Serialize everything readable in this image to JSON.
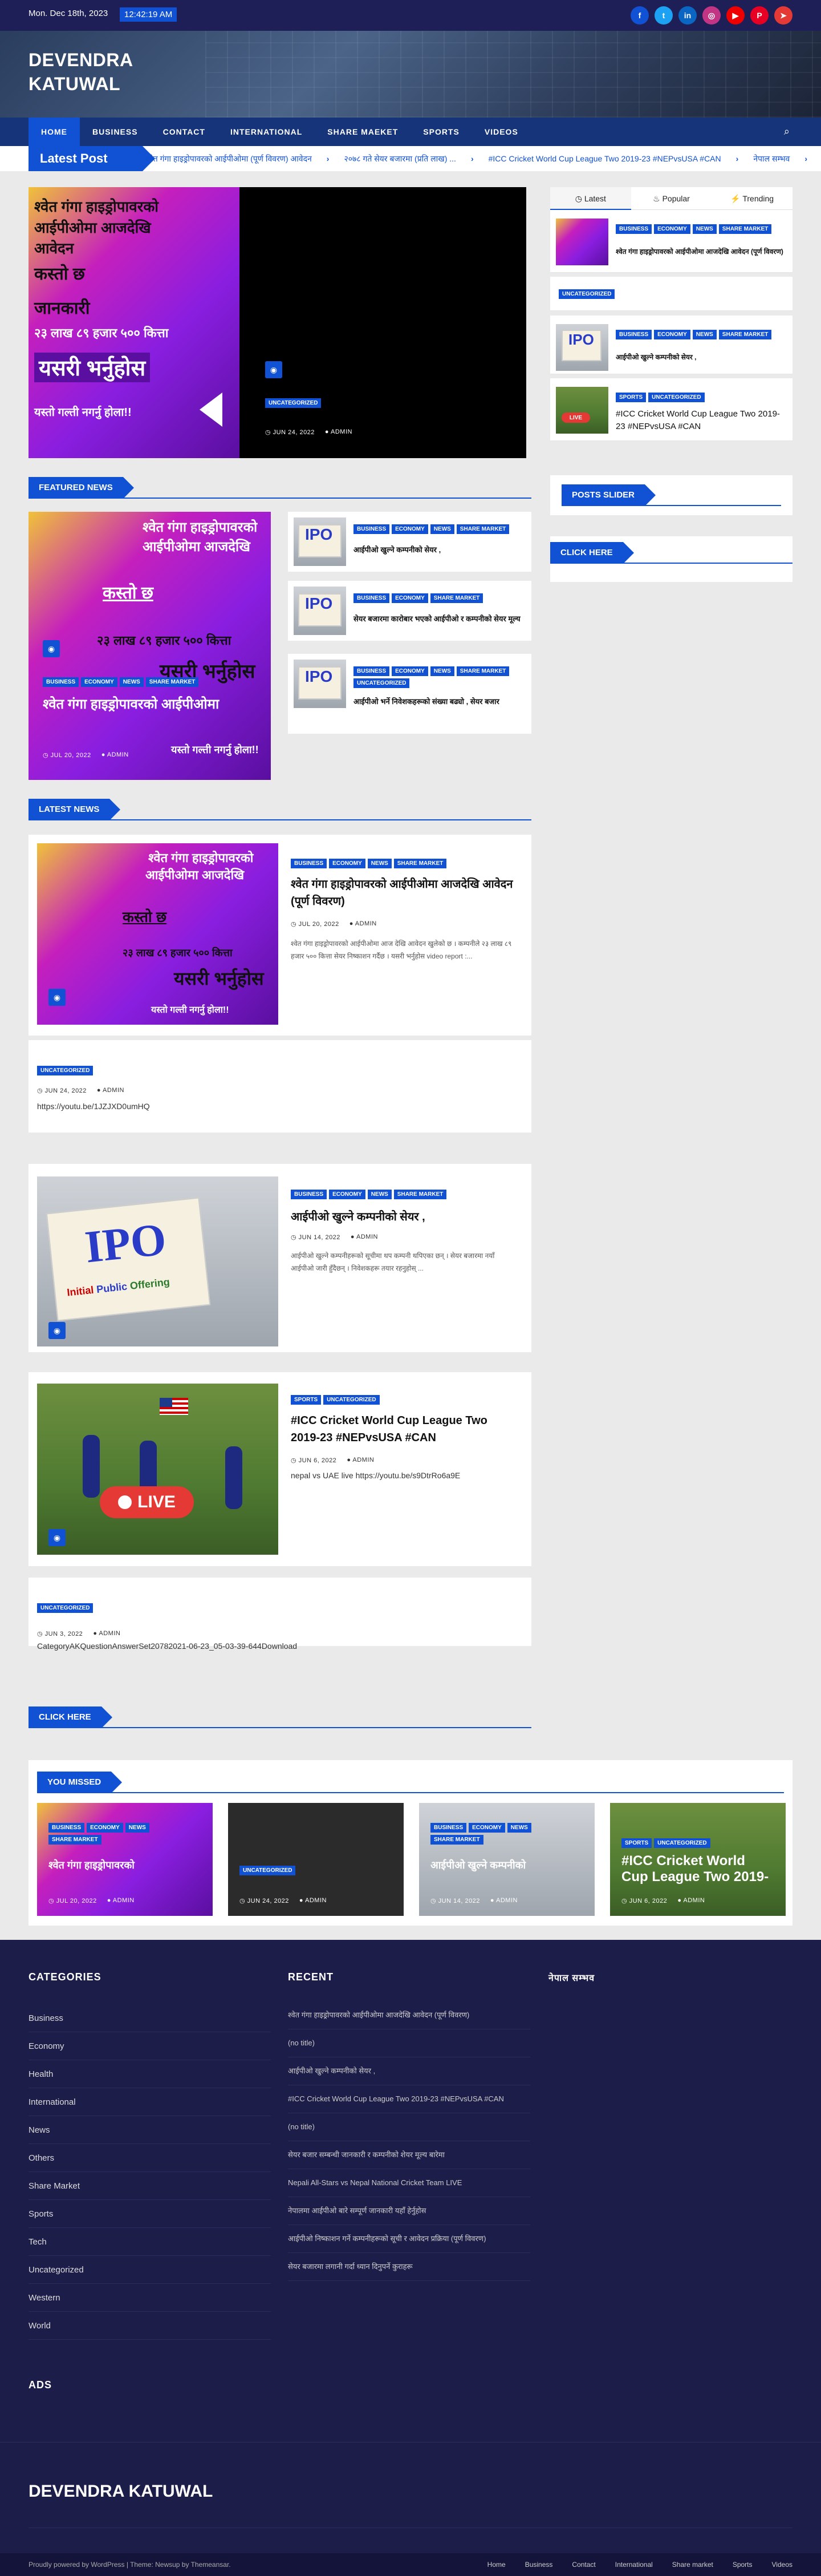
{
  "topbar": {
    "date": "Mon. Dec 18th, 2023",
    "time": "12:42:19 AM",
    "socials": [
      {
        "icon": "facebook-icon",
        "glyph": "f",
        "color": "#1151d3"
      },
      {
        "icon": "twitter-icon",
        "glyph": "t",
        "color": "#1da1f2"
      },
      {
        "icon": "linkedin-icon",
        "glyph": "in",
        "color": "#0a66c2"
      },
      {
        "icon": "instagram-icon",
        "glyph": "◎",
        "color": "#c13584"
      },
      {
        "icon": "youtube-icon",
        "glyph": "▶",
        "color": "#e00"
      },
      {
        "icon": "pinterest-icon",
        "glyph": "P",
        "color": "#e60023"
      },
      {
        "icon": "telegram-icon",
        "glyph": "➤",
        "color": "#e53935"
      }
    ]
  },
  "site": {
    "title": "DEVENDRA KATUWAL"
  },
  "nav": {
    "items": [
      "HOME",
      "BUSINESS",
      "CONTACT",
      "INTERNATIONAL",
      "SHARE MAEKET",
      "SPORTS",
      "VIDEOS"
    ],
    "search_icon": "search-icon"
  },
  "ticker": {
    "label": "Latest Post",
    "items": [
      "श्वेत गंगा हाइड्रोपावरको आईपीओमा (पूर्ण विवरण) आवेदन",
      "२०७८ गते सेयर बजारमा (प्रति लाख) ...",
      "#ICC Cricket World Cup League Two 2019-23 #NEPvsUSA #CAN",
      "नेपाल सम्भव"
    ]
  },
  "hero": {
    "main_image_lines": [
      "श्वेत गंगा हाइड्रोपावरको",
      "आईपीओमा आजदेखि",
      "आवेदन",
      "कस्तो छ",
      "जानकारी",
      "२३ लाख ८९ हजार ५०० कित्ता",
      "यसरी भर्नुहोस",
      "यस्तो गल्ती नगर्नु होला!!"
    ],
    "second_badge": "UNCATEGORIZED",
    "second_date": "JUN 24, 2022",
    "second_author": "ADMIN"
  },
  "sidebar": {
    "tabs": [
      "Latest",
      "Popular",
      "Trending"
    ],
    "items": [
      {
        "badges": [
          "BUSINESS",
          "ECONOMY",
          "NEWS",
          "SHARE MARKET"
        ],
        "title": "श्वेत गंगा हाइड्रोपावरको आईपीओमा आजदेखि आवेदन (पूर्ण विवरण)"
      },
      {
        "badges": [
          "UNCATEGORIZED"
        ],
        "title": ""
      },
      {
        "badges": [
          "BUSINESS",
          "ECONOMY",
          "NEWS",
          "SHARE MARKET"
        ],
        "title": "आईपीओ खुल्ने कम्पनीको सेयर ,"
      },
      {
        "badges": [
          "SPORTS",
          "UNCATEGORIZED"
        ],
        "title": "#ICC Cricket World Cup League Two 2019-23 #NEPvsUSA #CAN"
      }
    ],
    "posts_slider": "POSTS SLIDER",
    "click_here": "CLICK HERE"
  },
  "featured": {
    "title": "FEATURED NEWS",
    "main": {
      "badges": [
        "BUSINESS",
        "ECONOMY",
        "NEWS",
        "SHARE MARKET"
      ],
      "title": "श्वेत गंगा हाइड्रोपावरको आईपीओमा",
      "date": "JUL 20, 2022",
      "author": "ADMIN"
    },
    "side": [
      {
        "badges": [
          "BUSINESS",
          "ECONOMY",
          "NEWS",
          "SHARE MARKET"
        ],
        "title": "आईपीओ खुल्ने कम्पनीको सेयर ,"
      },
      {
        "badges": [
          "BUSINESS",
          "ECONOMY",
          "SHARE MARKET"
        ],
        "title": "सेयर बजारमा कारोबार भएको आईपीओ र कम्पनीको सेयर मूल्य"
      },
      {
        "badges": [
          "BUSINESS",
          "ECONOMY",
          "NEWS",
          "SHARE MARKET",
          "UNCATEGORIZED"
        ],
        "title": "आईपीओ भर्ने निवेशकहरूको संख्या बढ्यो , सेयर बजार"
      }
    ]
  },
  "latest": {
    "title": "LATEST NEWS",
    "posts": [
      {
        "badges": [
          "BUSINESS",
          "ECONOMY",
          "NEWS",
          "SHARE MARKET"
        ],
        "title": "श्वेत गंगा हाइड्रोपावरको आईपीओमा आजदेखि आवेदन (पूर्ण विवरण)",
        "date": "JUL 20, 2022",
        "author": "ADMIN",
        "excerpt": "श्वेत गंगा हाइड्रोपावरको आईपीओमा आज देखि आवेदन खुलेको छ । कम्पनीले २३ लाख ८९ हजार ५०० कित्ता सेयर निष्काशन गर्दैछ । यसरी भर्नुहोस video report :..."
      },
      {
        "badges": [
          "UNCATEGORIZED"
        ],
        "title": "",
        "date": "JUN 24, 2022",
        "author": "ADMIN",
        "excerpt": "https://youtu.be/1JZJXD0umHQ"
      },
      {
        "badges": [
          "BUSINESS",
          "ECONOMY",
          "NEWS",
          "SHARE MARKET"
        ],
        "title": "आईपीओ खुल्ने कम्पनीको सेयर ,",
        "date": "JUN 14, 2022",
        "author": "ADMIN",
        "excerpt": "आईपीओ खुल्ने कम्पनीहरूको सूचीमा थप कम्पनी थपिएका छन् । सेयर बजारमा नयाँ आईपीओ जारी हुँदैछन् । निवेशकहरू तयार रहनुहोस् ..."
      },
      {
        "badges": [
          "SPORTS",
          "UNCATEGORIZED"
        ],
        "title": "#ICC Cricket World Cup League Two 2019-23 #NEPvsUSA #CAN",
        "date": "JUN 6, 2022",
        "author": "ADMIN",
        "excerpt": "nepal vs UAE live https://youtu.be/s9DtrRo6a9E"
      },
      {
        "badges": [
          "UNCATEGORIZED"
        ],
        "title": "",
        "date": "JUN 3, 2022",
        "author": "ADMIN",
        "excerpt": "CategoryAKQuestionAnswerSet20782021-06-23_05-03-39-644Download"
      }
    ],
    "click_here": "CLICK HERE"
  },
  "missed": {
    "title": "YOU MISSED",
    "items": [
      {
        "badges": [
          "BUSINESS",
          "ECONOMY",
          "NEWS",
          "SHARE MARKET"
        ],
        "title": "श्वेत गंगा हाइड्रोपावरको",
        "date": "JUL 20, 2022",
        "author": "ADMIN"
      },
      {
        "badges": [
          "UNCATEGORIZED"
        ],
        "title": "",
        "date": "JUN 24, 2022",
        "author": "ADMIN"
      },
      {
        "badges": [
          "BUSINESS",
          "ECONOMY",
          "NEWS",
          "SHARE MARKET"
        ],
        "title": "आईपीओ खुल्ने कम्पनीको",
        "date": "JUN 14, 2022",
        "author": "ADMIN"
      },
      {
        "badges": [
          "SPORTS",
          "UNCATEGORIZED"
        ],
        "title": "#ICC Cricket World Cup League Two 2019-",
        "date": "JUN 6, 2022",
        "author": "ADMIN"
      }
    ]
  },
  "footer": {
    "categories_title": "CATEGORIES",
    "categories": [
      "Business",
      "Economy",
      "Health",
      "International",
      "News",
      "Others",
      "Share Market",
      "Sports",
      "Tech",
      "Uncategorized",
      "Western",
      "World"
    ],
    "recent_title": "RECENT",
    "recent": [
      "श्वेत गंगा हाइड्रोपावरको आईपीओमा आजदेखि आवेदन (पूर्ण विवरण)",
      "(no title)",
      "आईपीओ खुल्ने कम्पनीको सेयर ,",
      "#ICC Cricket World Cup League Two 2019-23 #NEPvsUSA #CAN",
      "(no title)",
      "सेयर बजार सम्बन्धी जानकारी र कम्पनीको शेयर मूल्य बारेमा",
      "Nepali All-Stars vs Nepal National Cricket Team LIVE",
      "नेपालमा आईपीओ बारे सम्पूर्ण जानकारी यहाँ हेर्नुहोस",
      "आईपीओ निष्काशन गर्ने कम्पनीहरूको सूची र आवेदन प्रक्रिया (पूर्ण विवरण)",
      "सेयर बजारमा लगानी गर्दा ध्यान दिनुपर्ने कुराहरू"
    ],
    "third_title": "नेपाल सम्भव",
    "ads_title": "ADS",
    "brand": "DEVENDRA KATUWAL",
    "credit": "Proudly powered by WordPress | Theme: Newsup by Themeansar.",
    "links": [
      "Home",
      "Business",
      "Contact",
      "International",
      "Share market",
      "Sports",
      "Videos"
    ]
  }
}
